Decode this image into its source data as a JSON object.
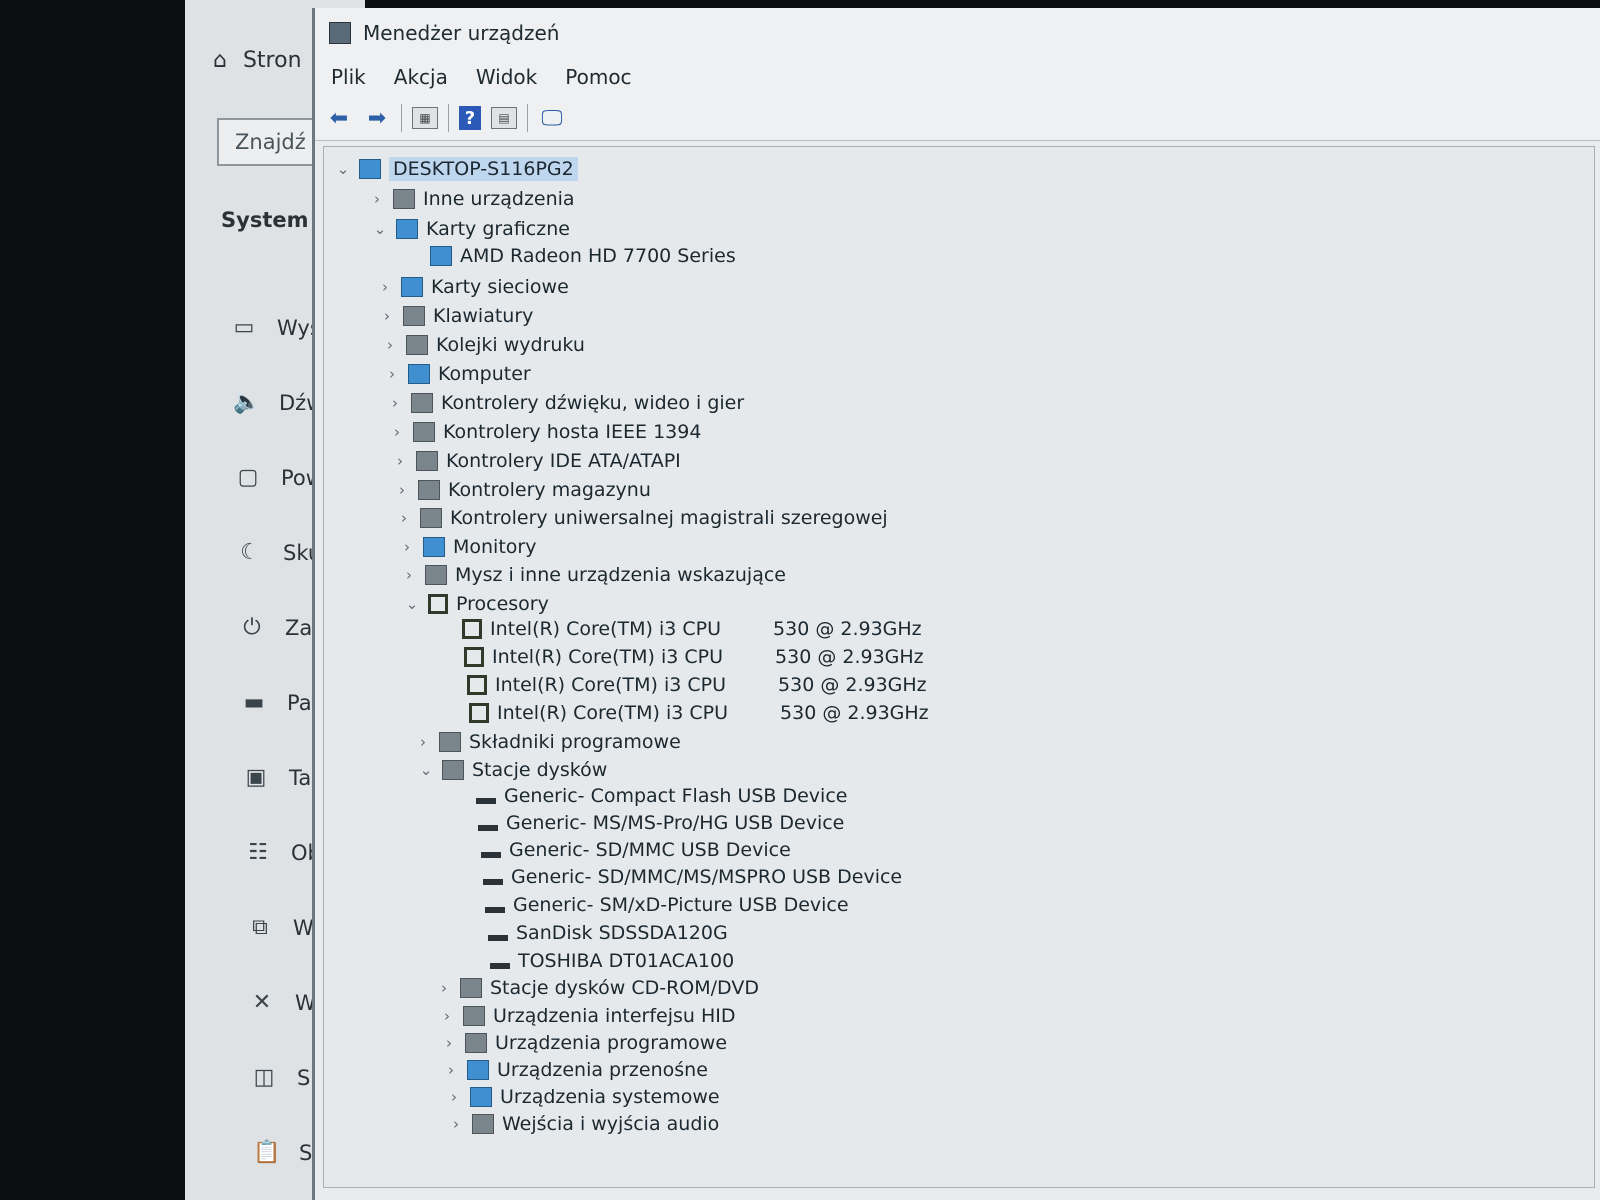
{
  "settings": {
    "home_label": "Stron",
    "search_placeholder": "Znajdź u",
    "section_title": "System",
    "nav": [
      {
        "icon": "monitor-icon",
        "label": "Wyśw"
      },
      {
        "icon": "speaker-icon",
        "label": "Dźwi"
      },
      {
        "icon": "notification-icon",
        "label": "Powi"
      },
      {
        "icon": "moon-icon",
        "label": "Skup"
      },
      {
        "icon": "power-icon",
        "label": "Zasil"
      },
      {
        "icon": "storage-icon",
        "label": "Pami"
      },
      {
        "icon": "tablet-icon",
        "label": "Table"
      },
      {
        "icon": "multitasking-icon",
        "label": "Obsł"
      },
      {
        "icon": "projecting-icon",
        "label": "Wyśw"
      },
      {
        "icon": "shared-icon",
        "label": "Wsp"
      },
      {
        "icon": "components-icon",
        "label": "Skład"
      },
      {
        "icon": "clipboard-icon",
        "label": "Scho"
      }
    ]
  },
  "devmgr": {
    "title": "Menedżer urządzeń",
    "menu": [
      "Plik",
      "Akcja",
      "Widok",
      "Pomoc"
    ],
    "toolbar": [
      "back-icon",
      "forward-icon",
      "properties-icon",
      "help-icon",
      "view-icon",
      "monitor-scan-icon"
    ],
    "tree": [
      {
        "level": 0,
        "expanded": true,
        "label": "DESKTOP-S116PG2",
        "icon": "computer-network-icon",
        "selected": true
      },
      {
        "level": 1,
        "expanded": false,
        "label": "Inne urządzenia",
        "icon": "unknown-device-icon"
      },
      {
        "level": 1,
        "expanded": true,
        "label": "Karty graficzne",
        "icon": "display-adapter-icon"
      },
      {
        "level": 2,
        "label": "AMD Radeon HD 7700 Series",
        "icon": "display-adapter-icon"
      },
      {
        "level": 1,
        "expanded": false,
        "label": "Karty sieciowe",
        "icon": "network-adapter-icon"
      },
      {
        "level": 1,
        "expanded": false,
        "label": "Klawiatury",
        "icon": "keyboard-icon"
      },
      {
        "level": 1,
        "expanded": false,
        "label": "Kolejki wydruku",
        "icon": "printer-icon"
      },
      {
        "level": 1,
        "expanded": false,
        "label": "Komputer",
        "icon": "computer-icon"
      },
      {
        "level": 1,
        "expanded": false,
        "label": "Kontrolery dźwięku, wideo i gier",
        "icon": "sound-icon"
      },
      {
        "level": 1,
        "expanded": false,
        "label": "Kontrolery hosta IEEE 1394",
        "icon": "firewire-icon"
      },
      {
        "level": 1,
        "expanded": false,
        "label": "Kontrolery IDE ATA/ATAPI",
        "icon": "ide-controller-icon"
      },
      {
        "level": 1,
        "expanded": false,
        "label": "Kontrolery magazynu",
        "icon": "storage-controller-icon"
      },
      {
        "level": 1,
        "expanded": false,
        "label": "Kontrolery uniwersalnej magistrali szeregowej",
        "icon": "usb-icon"
      },
      {
        "level": 1,
        "expanded": false,
        "label": "Monitory",
        "icon": "monitor-icon"
      },
      {
        "level": 1,
        "expanded": false,
        "label": "Mysz i inne urządzenia wskazujące",
        "icon": "mouse-icon"
      },
      {
        "level": 1,
        "expanded": true,
        "label": "Procesory",
        "icon": "cpu-icon"
      },
      {
        "level": 2,
        "label": "Intel(R) Core(TM) i3 CPU",
        "suffix": "530  @ 2.93GHz",
        "icon": "cpu-icon"
      },
      {
        "level": 2,
        "label": "Intel(R) Core(TM) i3 CPU",
        "suffix": "530  @ 2.93GHz",
        "icon": "cpu-icon"
      },
      {
        "level": 2,
        "label": "Intel(R) Core(TM) i3 CPU",
        "suffix": "530  @ 2.93GHz",
        "icon": "cpu-icon"
      },
      {
        "level": 2,
        "label": "Intel(R) Core(TM) i3 CPU",
        "suffix": "530  @ 2.93GHz",
        "icon": "cpu-icon"
      },
      {
        "level": 1,
        "expanded": false,
        "label": "Składniki programowe",
        "icon": "software-component-icon"
      },
      {
        "level": 1,
        "expanded": true,
        "label": "Stacje dysków",
        "icon": "disk-drive-icon"
      },
      {
        "level": 2,
        "label": "Generic- Compact Flash USB Device",
        "icon": "disk-drive-icon"
      },
      {
        "level": 2,
        "label": "Generic- MS/MS-Pro/HG USB Device",
        "icon": "disk-drive-icon"
      },
      {
        "level": 2,
        "label": "Generic- SD/MMC USB Device",
        "icon": "disk-drive-icon"
      },
      {
        "level": 2,
        "label": "Generic- SD/MMC/MS/MSPRO USB Device",
        "icon": "disk-drive-icon"
      },
      {
        "level": 2,
        "label": "Generic- SM/xD-Picture USB Device",
        "icon": "disk-drive-icon"
      },
      {
        "level": 2,
        "label": "SanDisk SDSSDA120G",
        "icon": "disk-drive-icon"
      },
      {
        "level": 2,
        "label": "TOSHIBA DT01ACA100",
        "icon": "disk-drive-icon"
      },
      {
        "level": 1,
        "expanded": false,
        "label": "Stacje dysków CD-ROM/DVD",
        "icon": "dvd-drive-icon"
      },
      {
        "level": 1,
        "expanded": false,
        "label": "Urządzenia interfejsu HID",
        "icon": "hid-icon"
      },
      {
        "level": 1,
        "expanded": false,
        "label": "Urządzenia programowe",
        "icon": "software-device-icon"
      },
      {
        "level": 1,
        "expanded": false,
        "label": "Urządzenia przenośne",
        "icon": "portable-device-icon"
      },
      {
        "level": 1,
        "expanded": false,
        "label": "Urządzenia systemowe",
        "icon": "system-device-icon"
      },
      {
        "level": 1,
        "expanded": false,
        "label": "Wejścia i wyjścia audio",
        "icon": "audio-io-icon"
      }
    ]
  }
}
